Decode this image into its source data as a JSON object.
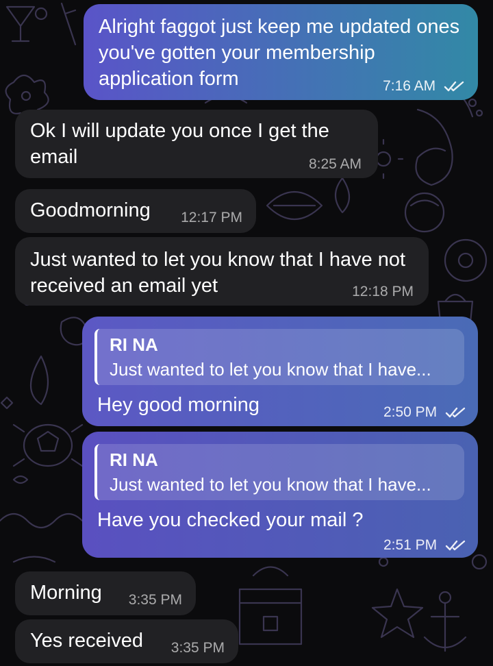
{
  "colors": {
    "background": "#0b0b0d",
    "incoming_bubble": "#212124",
    "outgoing_gradient_start": "#5a54c8",
    "outgoing_gradient_end": "#3289a6",
    "doodle_lines": "#3a3550"
  },
  "icons": {
    "read_receipt": "double-check-icon"
  },
  "messages": [
    {
      "direction": "outgoing",
      "text": "Alright faggot just keep me updated ones you've gotten your membership application form",
      "time": "7:16 AM",
      "read": true
    },
    {
      "direction": "incoming",
      "text": "Ok I will update you once I get the email",
      "time": "8:25 AM"
    },
    {
      "direction": "incoming",
      "text": "Goodmorning",
      "time": "12:17 PM"
    },
    {
      "direction": "incoming",
      "text": "Just wanted to let you know that I have not received an email yet",
      "time": "12:18 PM"
    },
    {
      "direction": "outgoing",
      "reply_to": {
        "name": "RI NA",
        "snippet": "Just wanted to let you know that I have..."
      },
      "text": "Hey good morning",
      "time": "2:50 PM",
      "read": true
    },
    {
      "direction": "outgoing",
      "reply_to": {
        "name": "RI NA",
        "snippet": "Just wanted to let you know that I have..."
      },
      "text": "Have you checked your mail ?",
      "time": "2:51 PM",
      "read": true
    },
    {
      "direction": "incoming",
      "text": "Morning",
      "time": "3:35 PM"
    },
    {
      "direction": "incoming",
      "text": "Yes received",
      "time": "3:35 PM"
    }
  ]
}
